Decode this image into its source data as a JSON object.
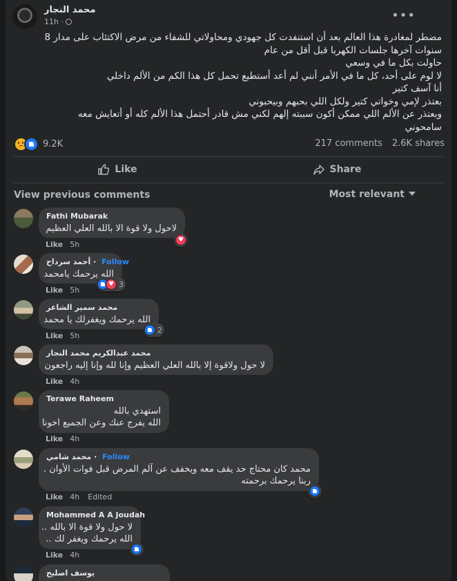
{
  "post": {
    "author": "محمد النجار",
    "time": "11h",
    "text_lines": [
      "مضطر لمغادرة هذا العالم بعد أن استنفدت كل جهودي ومحاولاتي للشفاء من مرض الاكتئاب على مدار 8",
      "سنوات آخرها جلسات الكهربا قبل أقل من عام",
      "حاولت بكل ما في وسعي",
      "لا لوم على أحد، كل ما في الأمر أنني لم أعد أستطيع تحمل كل هذا الكم من الألم داخلي",
      "أنا آسف كتير",
      "بعتذر لإمي وخواتي كتير ولكل اللي بحبهم وبيحبوني",
      "وبعتذر عن الألم اللي ممكن أكون سببته إلهم لكني مش قادر أحتمل هذا الألم كله أو أتعايش معه",
      "سامحوني"
    ],
    "reaction_count": "9.2K",
    "comments_count": "217 comments",
    "shares_count": "2.6K shares",
    "like_label": "Like",
    "share_label": "Share"
  },
  "comments_header": {
    "view_previous": "View previous comments",
    "sort": "Most relevant"
  },
  "comments": [
    {
      "name": "Fathi Mubarak",
      "follow": "",
      "lines": [
        "لاحول ولا قوة الا بالله العلي العظيم"
      ],
      "like": "Like",
      "time": "5h",
      "edited": "",
      "reaction_count": ""
    },
    {
      "name": "أحمد سرداح",
      "follow": "Follow",
      "lines": [
        "الله يرحمك يامحمد"
      ],
      "like": "Like",
      "time": "5h",
      "edited": "",
      "reaction_count": "3"
    },
    {
      "name": "محمد سمير الشاعر",
      "follow": "",
      "lines": [
        "الله يرحمك ويغفرلك يا محمد"
      ],
      "like": "Like",
      "time": "5h",
      "edited": "",
      "reaction_count": "2"
    },
    {
      "name": "محمد عبدالكريم محمد النجار",
      "follow": "",
      "lines": [
        "لا حول ولاقوة إلا بالله العلي العظيم وإنا لله وإنا إليه راجعون"
      ],
      "like": "Like",
      "time": "4h",
      "edited": "",
      "reaction_count": ""
    },
    {
      "name": "Terawe Raheem",
      "follow": "",
      "lines": [
        "استهدي بالله",
        "الله يفرج عنك وعن الجميع اخونا"
      ],
      "like": "Like",
      "time": "4h",
      "edited": "",
      "reaction_count": ""
    },
    {
      "name": "محمد شامي",
      "follow": "Follow",
      "lines": [
        "محمد كان محتاج حد يقف معه ويخفف عن آلم المرض قبل فوات الأوان .",
        "ربنا يرحمك برحمته"
      ],
      "like": "Like",
      "time": "4h",
      "edited": "Edited",
      "reaction_count": ""
    },
    {
      "name": "Mohammed A A Joudah",
      "follow": "",
      "lines": [
        "لا حول ولا قوة الا بالله ..",
        "الله يرحمك ويغفر لك .."
      ],
      "like": "Like",
      "time": "4h",
      "edited": "",
      "reaction_count": ""
    },
    {
      "name": "يوسف اصليح",
      "follow": "",
      "lines": [
        ""
      ],
      "like": "",
      "time": "",
      "edited": "",
      "reaction_count": ""
    }
  ],
  "colors": {
    "background": "#18191a",
    "card": "#242526",
    "bubble": "#3a3b3c",
    "text": "#e4e6eb",
    "muted": "#b0b3b8",
    "link": "#2d88ff",
    "like_blue": "#2078f4",
    "love_red": "#f33e58"
  },
  "icons": [
    "globe-icon",
    "more-dots-icon",
    "sad-reaction-icon",
    "like-reaction-icon",
    "love-reaction-icon",
    "thumbs-up-icon",
    "share-arrow-icon",
    "caret-down-icon"
  ]
}
